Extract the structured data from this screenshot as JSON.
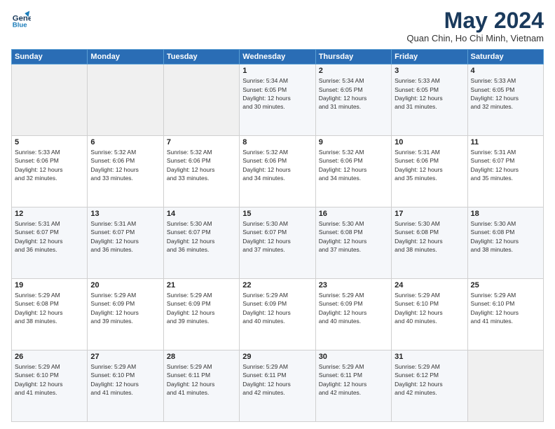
{
  "logo": {
    "line1": "General",
    "line2": "Blue"
  },
  "title": {
    "month_year": "May 2024",
    "location": "Quan Chin, Ho Chi Minh, Vietnam"
  },
  "headers": [
    "Sunday",
    "Monday",
    "Tuesday",
    "Wednesday",
    "Thursday",
    "Friday",
    "Saturday"
  ],
  "weeks": [
    [
      {
        "day": "",
        "info": ""
      },
      {
        "day": "",
        "info": ""
      },
      {
        "day": "",
        "info": ""
      },
      {
        "day": "1",
        "info": "Sunrise: 5:34 AM\nSunset: 6:05 PM\nDaylight: 12 hours\nand 30 minutes."
      },
      {
        "day": "2",
        "info": "Sunrise: 5:34 AM\nSunset: 6:05 PM\nDaylight: 12 hours\nand 31 minutes."
      },
      {
        "day": "3",
        "info": "Sunrise: 5:33 AM\nSunset: 6:05 PM\nDaylight: 12 hours\nand 31 minutes."
      },
      {
        "day": "4",
        "info": "Sunrise: 5:33 AM\nSunset: 6:05 PM\nDaylight: 12 hours\nand 32 minutes."
      }
    ],
    [
      {
        "day": "5",
        "info": "Sunrise: 5:33 AM\nSunset: 6:06 PM\nDaylight: 12 hours\nand 32 minutes."
      },
      {
        "day": "6",
        "info": "Sunrise: 5:32 AM\nSunset: 6:06 PM\nDaylight: 12 hours\nand 33 minutes."
      },
      {
        "day": "7",
        "info": "Sunrise: 5:32 AM\nSunset: 6:06 PM\nDaylight: 12 hours\nand 33 minutes."
      },
      {
        "day": "8",
        "info": "Sunrise: 5:32 AM\nSunset: 6:06 PM\nDaylight: 12 hours\nand 34 minutes."
      },
      {
        "day": "9",
        "info": "Sunrise: 5:32 AM\nSunset: 6:06 PM\nDaylight: 12 hours\nand 34 minutes."
      },
      {
        "day": "10",
        "info": "Sunrise: 5:31 AM\nSunset: 6:06 PM\nDaylight: 12 hours\nand 35 minutes."
      },
      {
        "day": "11",
        "info": "Sunrise: 5:31 AM\nSunset: 6:07 PM\nDaylight: 12 hours\nand 35 minutes."
      }
    ],
    [
      {
        "day": "12",
        "info": "Sunrise: 5:31 AM\nSunset: 6:07 PM\nDaylight: 12 hours\nand 36 minutes."
      },
      {
        "day": "13",
        "info": "Sunrise: 5:31 AM\nSunset: 6:07 PM\nDaylight: 12 hours\nand 36 minutes."
      },
      {
        "day": "14",
        "info": "Sunrise: 5:30 AM\nSunset: 6:07 PM\nDaylight: 12 hours\nand 36 minutes."
      },
      {
        "day": "15",
        "info": "Sunrise: 5:30 AM\nSunset: 6:07 PM\nDaylight: 12 hours\nand 37 minutes."
      },
      {
        "day": "16",
        "info": "Sunrise: 5:30 AM\nSunset: 6:08 PM\nDaylight: 12 hours\nand 37 minutes."
      },
      {
        "day": "17",
        "info": "Sunrise: 5:30 AM\nSunset: 6:08 PM\nDaylight: 12 hours\nand 38 minutes."
      },
      {
        "day": "18",
        "info": "Sunrise: 5:30 AM\nSunset: 6:08 PM\nDaylight: 12 hours\nand 38 minutes."
      }
    ],
    [
      {
        "day": "19",
        "info": "Sunrise: 5:29 AM\nSunset: 6:08 PM\nDaylight: 12 hours\nand 38 minutes."
      },
      {
        "day": "20",
        "info": "Sunrise: 5:29 AM\nSunset: 6:09 PM\nDaylight: 12 hours\nand 39 minutes."
      },
      {
        "day": "21",
        "info": "Sunrise: 5:29 AM\nSunset: 6:09 PM\nDaylight: 12 hours\nand 39 minutes."
      },
      {
        "day": "22",
        "info": "Sunrise: 5:29 AM\nSunset: 6:09 PM\nDaylight: 12 hours\nand 40 minutes."
      },
      {
        "day": "23",
        "info": "Sunrise: 5:29 AM\nSunset: 6:09 PM\nDaylight: 12 hours\nand 40 minutes."
      },
      {
        "day": "24",
        "info": "Sunrise: 5:29 AM\nSunset: 6:10 PM\nDaylight: 12 hours\nand 40 minutes."
      },
      {
        "day": "25",
        "info": "Sunrise: 5:29 AM\nSunset: 6:10 PM\nDaylight: 12 hours\nand 41 minutes."
      }
    ],
    [
      {
        "day": "26",
        "info": "Sunrise: 5:29 AM\nSunset: 6:10 PM\nDaylight: 12 hours\nand 41 minutes."
      },
      {
        "day": "27",
        "info": "Sunrise: 5:29 AM\nSunset: 6:10 PM\nDaylight: 12 hours\nand 41 minutes."
      },
      {
        "day": "28",
        "info": "Sunrise: 5:29 AM\nSunset: 6:11 PM\nDaylight: 12 hours\nand 41 minutes."
      },
      {
        "day": "29",
        "info": "Sunrise: 5:29 AM\nSunset: 6:11 PM\nDaylight: 12 hours\nand 42 minutes."
      },
      {
        "day": "30",
        "info": "Sunrise: 5:29 AM\nSunset: 6:11 PM\nDaylight: 12 hours\nand 42 minutes."
      },
      {
        "day": "31",
        "info": "Sunrise: 5:29 AM\nSunset: 6:12 PM\nDaylight: 12 hours\nand 42 minutes."
      },
      {
        "day": "",
        "info": ""
      }
    ]
  ]
}
